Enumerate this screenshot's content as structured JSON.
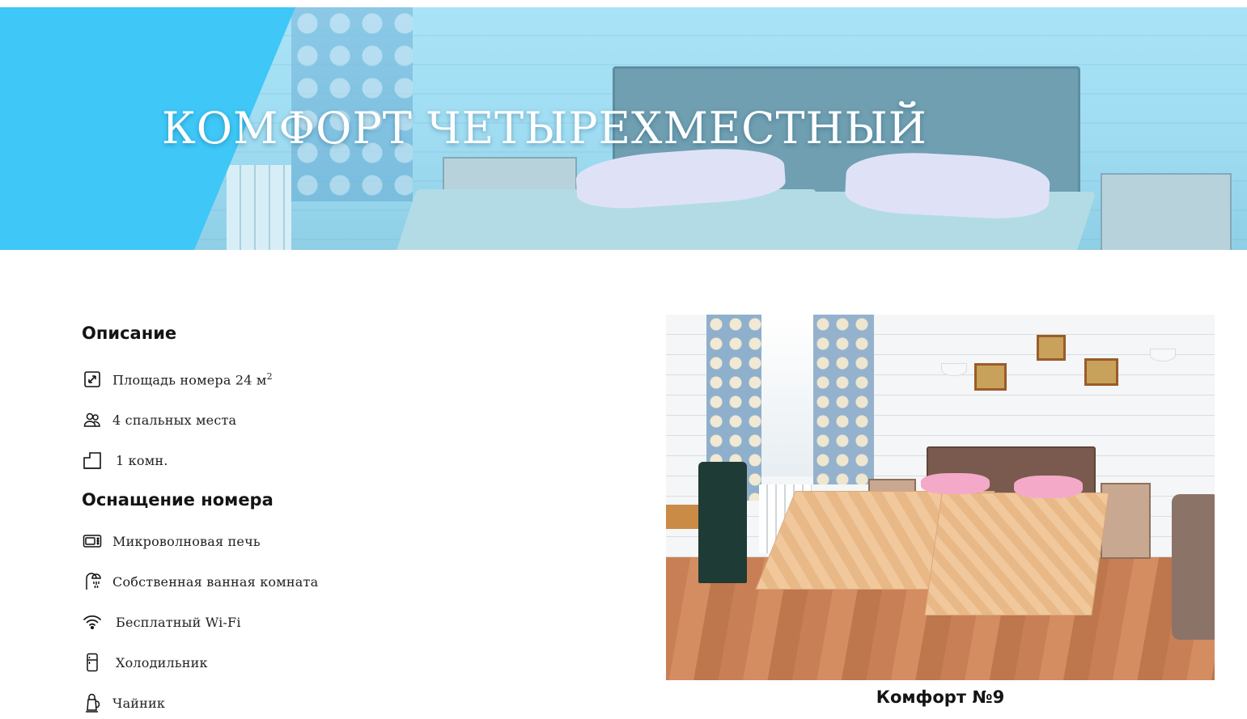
{
  "hero": {
    "title": "КОМФОРТ ЧЕТЫРЕХМЕСТНЫЙ",
    "accent_color": "#3ec7f7"
  },
  "description": {
    "heading": "Описание",
    "items": [
      {
        "icon": "area-icon",
        "text": "Площадь номера 24 м",
        "sup": "2"
      },
      {
        "icon": "people-icon",
        "text": "4 спальных места"
      },
      {
        "icon": "rooms-icon",
        "text": "1 комн."
      }
    ]
  },
  "equipment": {
    "heading": "Оснащение номера",
    "items": [
      {
        "icon": "microwave-icon",
        "text": "Микроволновая печь"
      },
      {
        "icon": "shower-icon",
        "text": "Собственная ванная комната"
      },
      {
        "icon": "wifi-icon",
        "text": "Бесплатный Wi-Fi"
      },
      {
        "icon": "fridge-icon",
        "text": "Холодильник"
      },
      {
        "icon": "kettle-icon",
        "text": "Чайник"
      }
    ]
  },
  "gallery": {
    "caption": "Комфорт №9"
  }
}
